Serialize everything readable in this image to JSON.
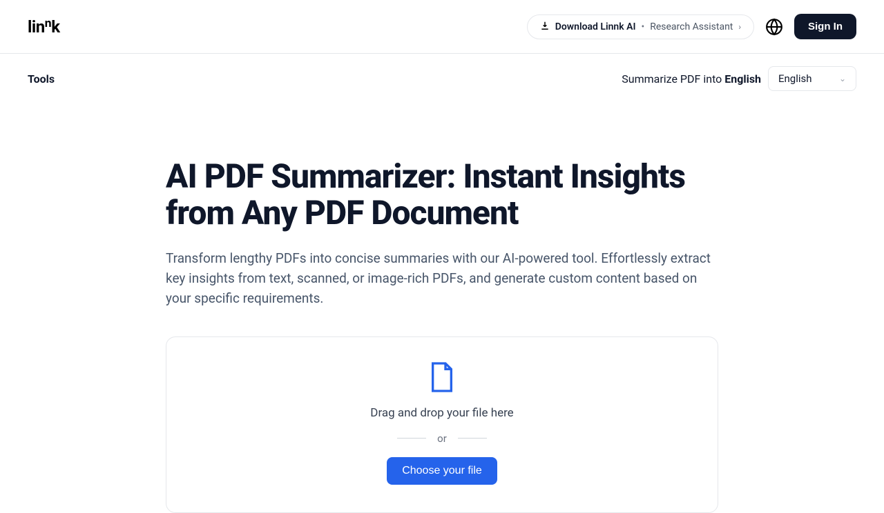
{
  "header": {
    "logo": "linⁿk",
    "download_label": "Download Linnk AI",
    "research_label": "Research Assistant",
    "signin_label": "Sign In"
  },
  "subheader": {
    "tools_label": "Tools",
    "summarize_prefix": "Summarize PDF into ",
    "summarize_lang": "English",
    "lang_selected": "English"
  },
  "hero": {
    "title": "AI PDF Summarizer: Instant Insights from Any PDF Document",
    "subtitle": "Transform lengthy PDFs into concise summaries with our AI-powered tool. Effortlessly extract key insights from text, scanned, or image-rich PDFs, and generate custom content based on your specific requirements."
  },
  "dropzone": {
    "drag_text": "Drag and drop your file here",
    "or_text": "or",
    "choose_label": "Choose your file"
  }
}
